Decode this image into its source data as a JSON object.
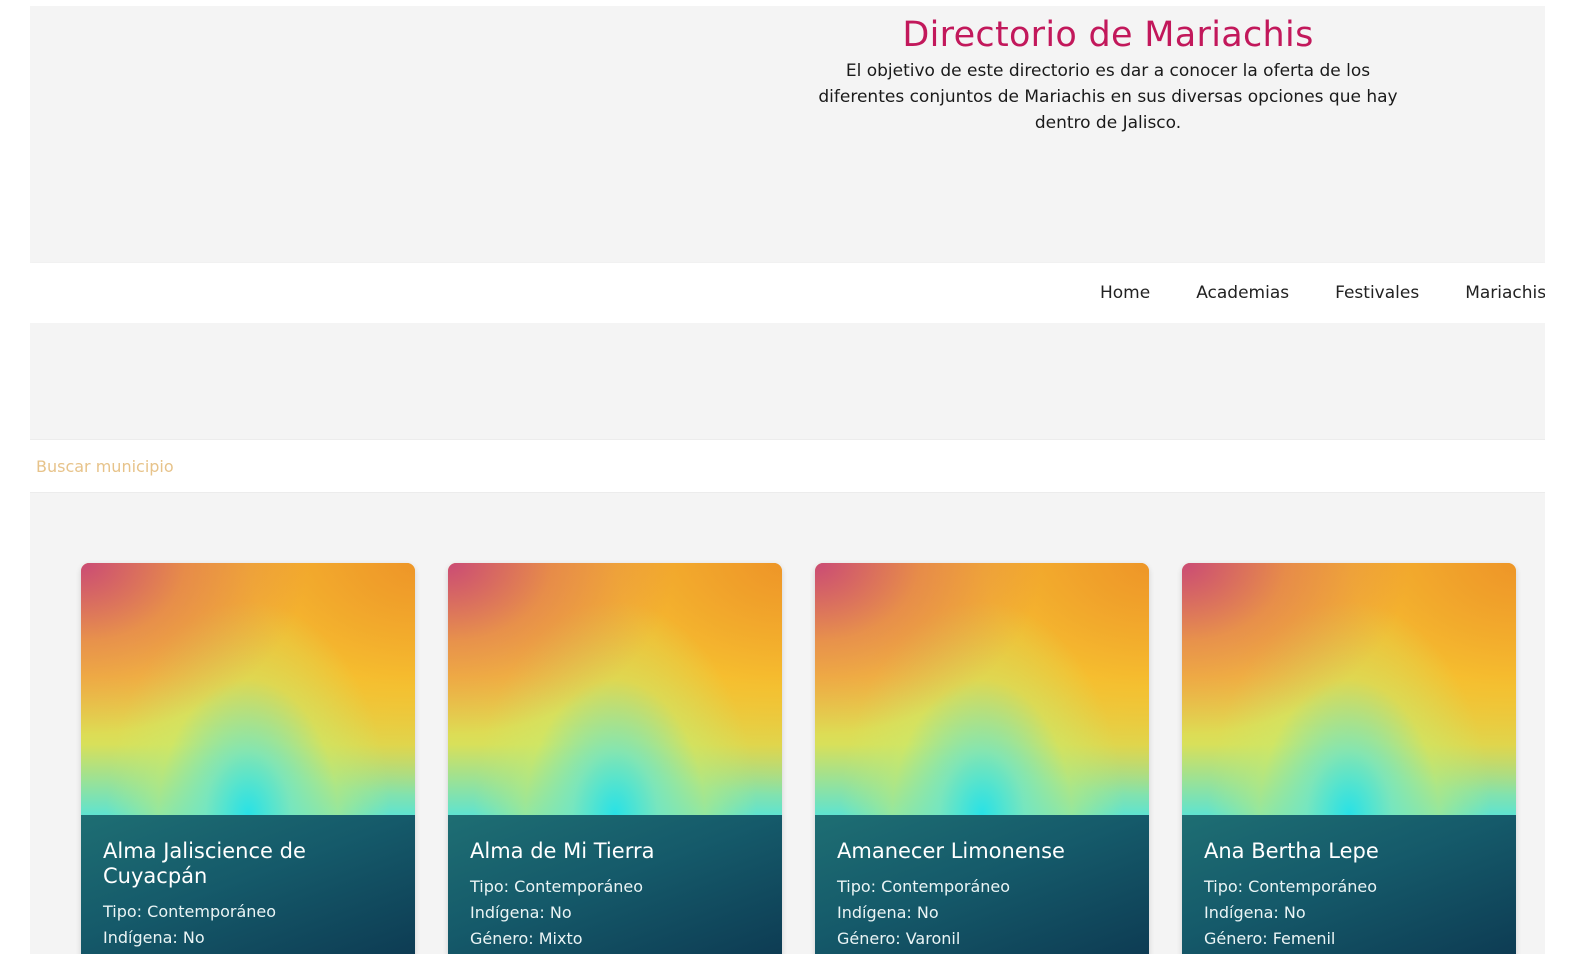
{
  "header": {
    "title": "Directorio de Mariachis",
    "description": "El objetivo de este directorio es dar a conocer la oferta de los diferentes conjuntos de Mariachis en sus diversas opciones que hay dentro de Jalisco."
  },
  "nav": {
    "items": [
      {
        "label": "Home"
      },
      {
        "label": "Academias"
      },
      {
        "label": "Festivales"
      },
      {
        "label": "Mariachis"
      }
    ]
  },
  "search": {
    "placeholder": "Buscar municipio",
    "value": ""
  },
  "cards": [
    {
      "name": "Alma Jaliscience de Cuyacpán",
      "tipo": "Tipo: Contemporáneo",
      "indigena": "Indígena: No",
      "genero": ""
    },
    {
      "name": "Alma de Mi Tierra",
      "tipo": "Tipo: Contemporáneo",
      "indigena": "Indígena: No",
      "genero": "Género: Mixto"
    },
    {
      "name": "Amanecer Limonense",
      "tipo": "Tipo: Contemporáneo",
      "indigena": "Indígena: No",
      "genero": "Género: Varonil"
    },
    {
      "name": "Ana Bertha Lepe",
      "tipo": "Tipo: Contemporáneo",
      "indigena": "Indígena: No",
      "genero": "Género: Femenil"
    }
  ],
  "colors": {
    "title": "#c2185b",
    "card_footer": "#155a6a",
    "placeholder": "#e7c38a"
  }
}
